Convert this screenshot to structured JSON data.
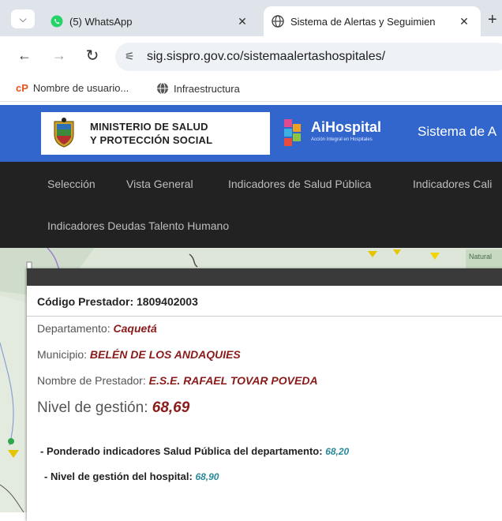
{
  "browser": {
    "tabs": [
      {
        "title": "(5) WhatsApp",
        "icon": "whatsapp-icon",
        "active": false
      },
      {
        "title": "Sistema de Alertas y Seguimien",
        "icon": "globe-icon",
        "active": true
      }
    ],
    "url": "sig.sispro.gov.co/sistemaalertashospitales/",
    "bookmarks": [
      {
        "label": "Nombre de usuario...",
        "icon": "bookmark-cp-icon"
      },
      {
        "label": "Infraestructura",
        "icon": "globe-icon"
      }
    ]
  },
  "header": {
    "ministry_line1": "MINISTERIO DE SALUD",
    "ministry_line2": "Y PROTECCIÓN SOCIAL",
    "aihospital_title": "AiHospital",
    "aihospital_subtitle": "Acción Integral en Hospitales",
    "system_title": "Sistema de A"
  },
  "nav": {
    "items": [
      "Selección",
      "Vista General",
      "Indicadores de Salud Pública",
      "Indicadores Cali",
      "Indicadores Deudas Talento Humano"
    ]
  },
  "map": {
    "label": "Natural"
  },
  "popup": {
    "codigo_label": "Código Prestador:",
    "codigo_value": "1809402003",
    "departamento_label": "Departamento:",
    "departamento_value": "Caquetá",
    "municipio_label": "Municipio:",
    "municipio_value": "BELÉN DE LOS ANDAQUIES",
    "prestador_label": "Nombre de Prestador:",
    "prestador_value": "E.S.E. RAFAEL TOVAR POVEDA",
    "nivel_label": "Nivel de gestión:",
    "nivel_value": "68,69",
    "ponderado_label": "- Ponderado indicadores Salud Pública del departamento:",
    "ponderado_value": "68,20",
    "hospital_label": "- Nivel de gestión del hospital:",
    "hospital_value": "68,90"
  },
  "colors": {
    "header_blue": "#3366cc",
    "nav_dark": "#222222",
    "value_red": "#8b1a1a",
    "value_teal": "#2a8a9a"
  }
}
